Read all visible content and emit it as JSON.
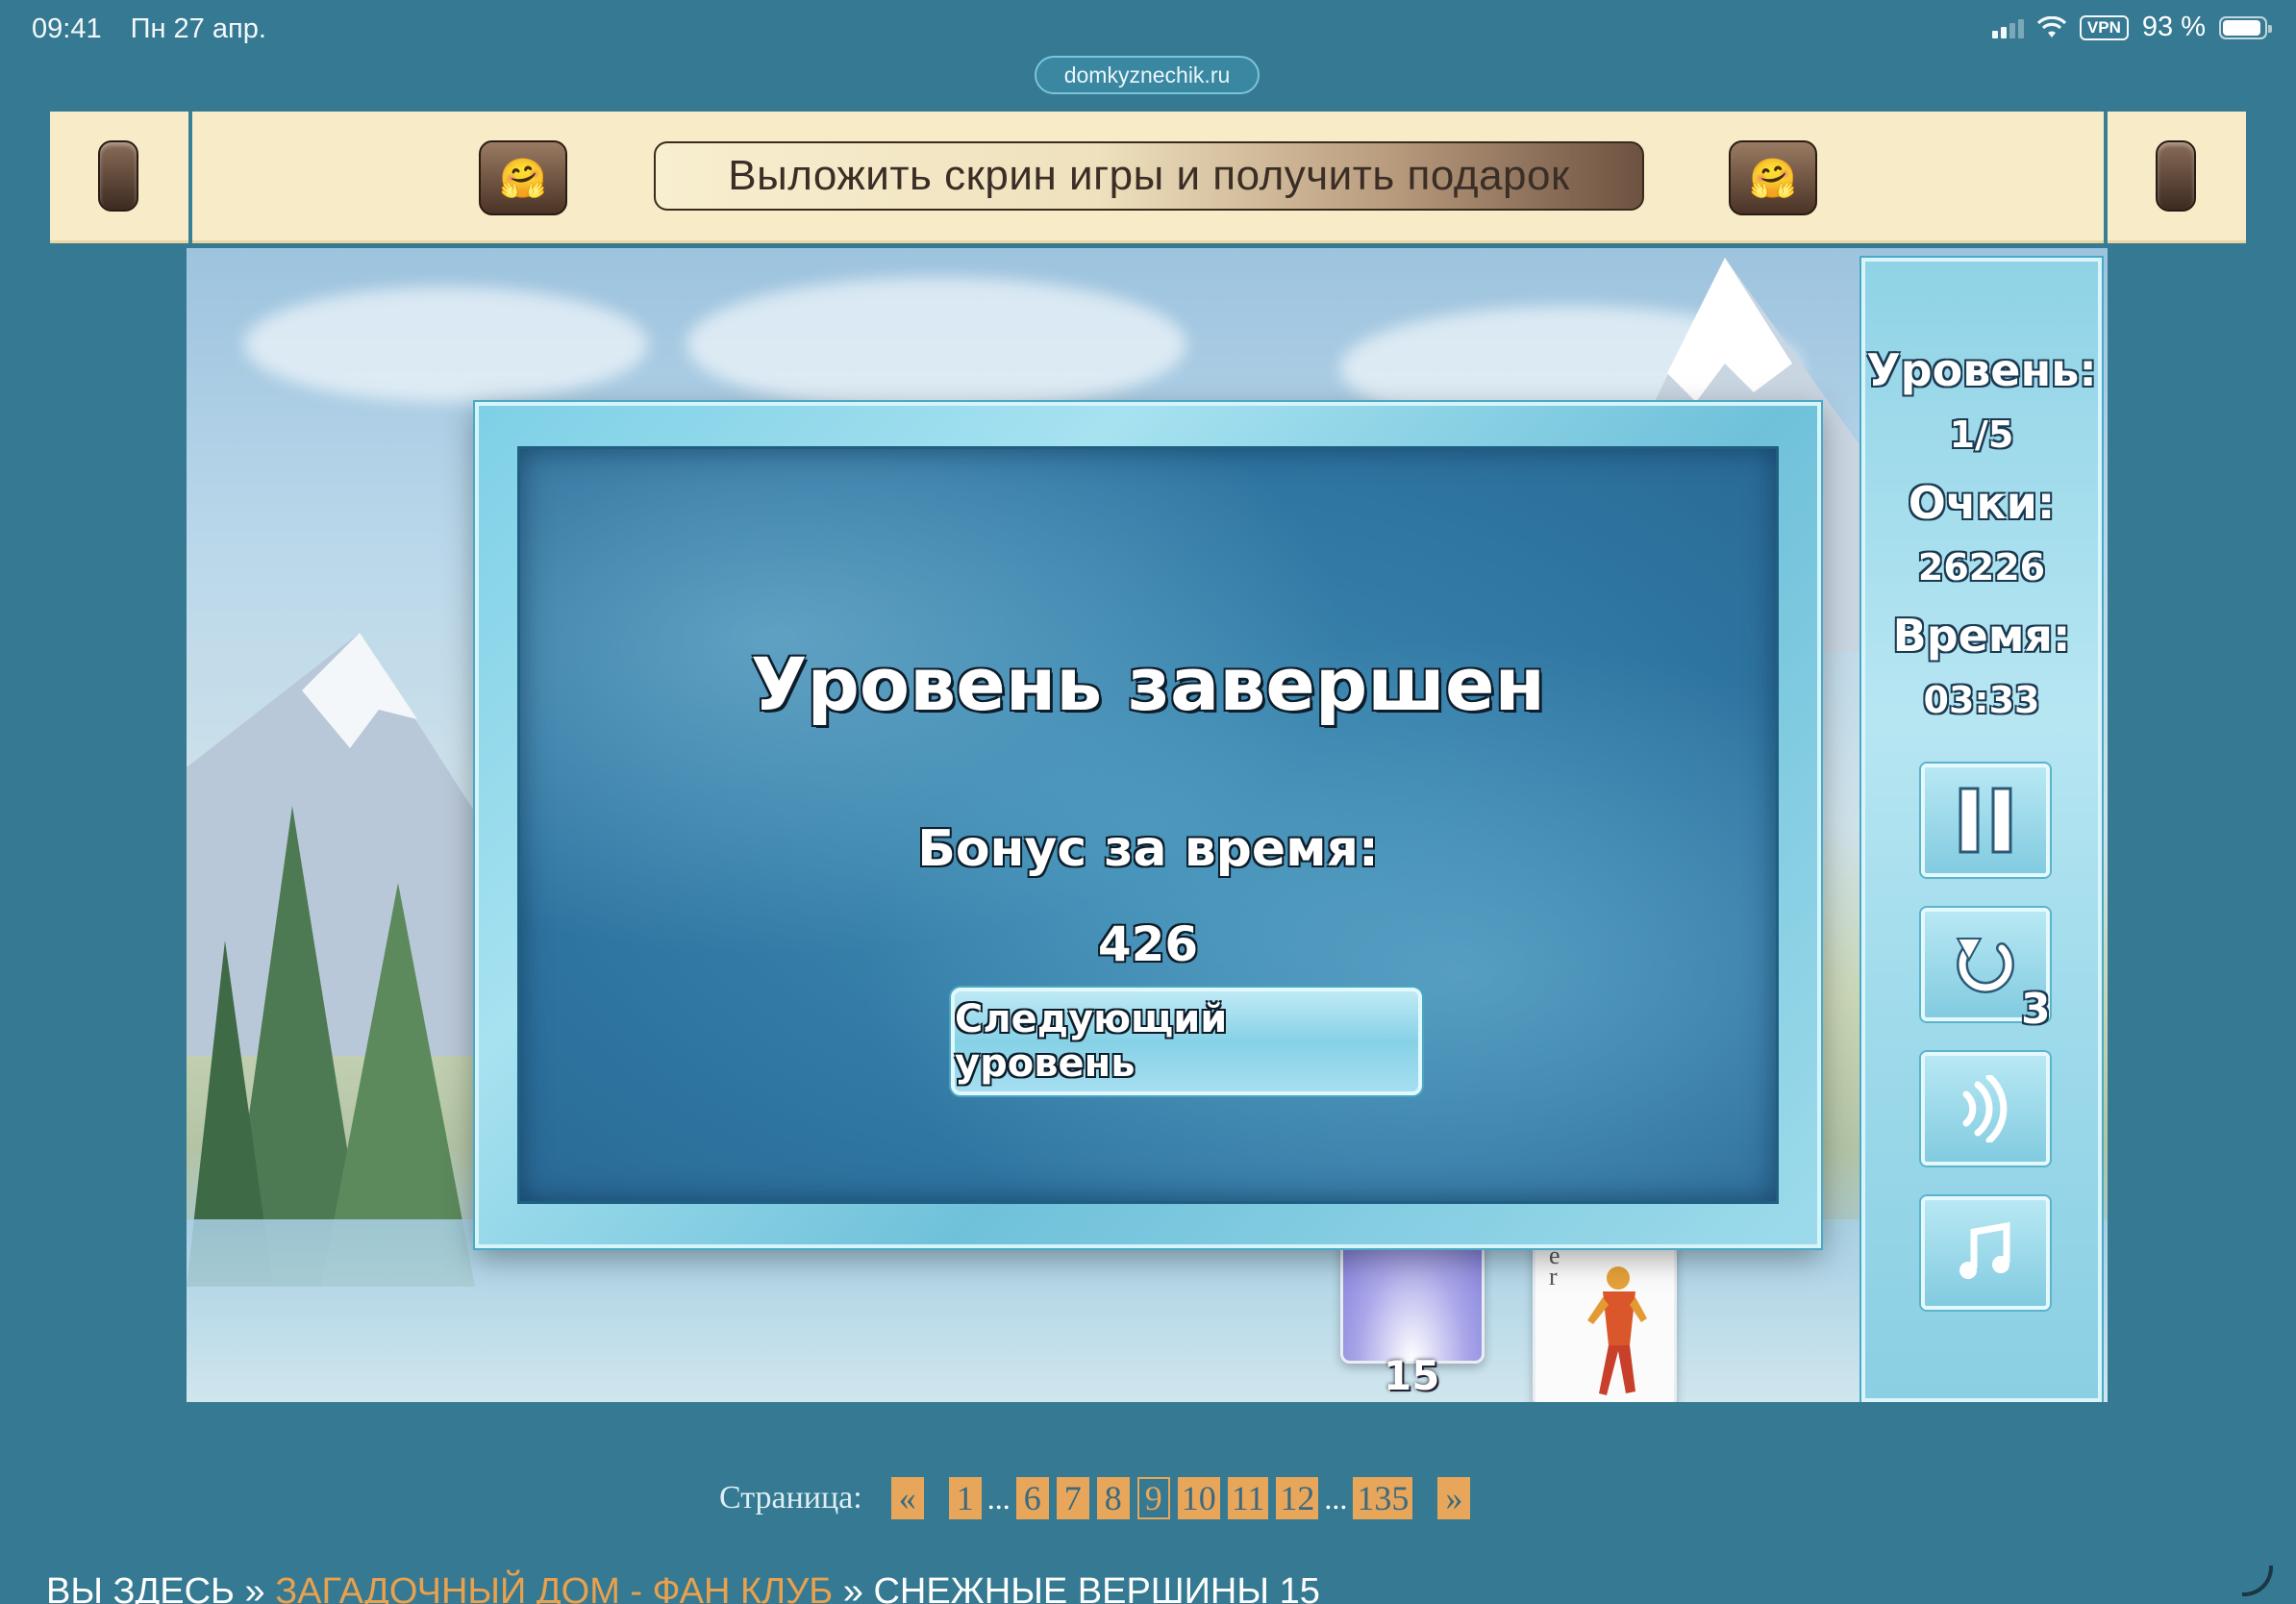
{
  "status_bar": {
    "time": "09:41",
    "date": "Пн 27 апр.",
    "vpn": "VPN",
    "battery": "93 %",
    "battery_level": 0.93
  },
  "browser": {
    "url": "domkyznechik.ru"
  },
  "banner": {
    "gift_button_label": "Выложить скрин игры и получить подарок",
    "emoji_left": "🤗",
    "emoji_right": "🤗"
  },
  "game": {
    "panel": {
      "level_label": "Уровень:",
      "level_value": "1/5",
      "score_label": "Очки:",
      "score_value": "26226",
      "time_label": "Время:",
      "time_value": "03:33",
      "restart_count": "3",
      "buttons": [
        "pause-icon",
        "restart-icon",
        "sound-icon",
        "music-icon"
      ]
    },
    "dialog": {
      "title": "Уровень завершен",
      "bonus_label": "Бонус за время:",
      "bonus_value": "426",
      "next_button": "Следующий уровень"
    },
    "deck_count": "15",
    "card_letters": [
      "e",
      "r"
    ]
  },
  "pagination": {
    "label": "Страница:",
    "prev": "«",
    "next": "»",
    "pages": [
      "1",
      "6",
      "7",
      "8",
      "9",
      "10",
      "11",
      "12",
      "135"
    ],
    "current": "9",
    "ellipsis": "..."
  },
  "breadcrumb": {
    "prefix": "ВЫ ЗДЕСЬ",
    "separator": "»",
    "link": "ЗАГАДОЧНЫЙ ДОМ - ФАН КЛУБ",
    "current": "СНЕЖНЫЕ ВЕРШИНЫ 15"
  },
  "colors": {
    "page_bg": "#357a92",
    "banner_bg": "#f7ecc7",
    "pagination_accent": "#e8a65a",
    "breadcrumb_link": "#e9a14e"
  }
}
